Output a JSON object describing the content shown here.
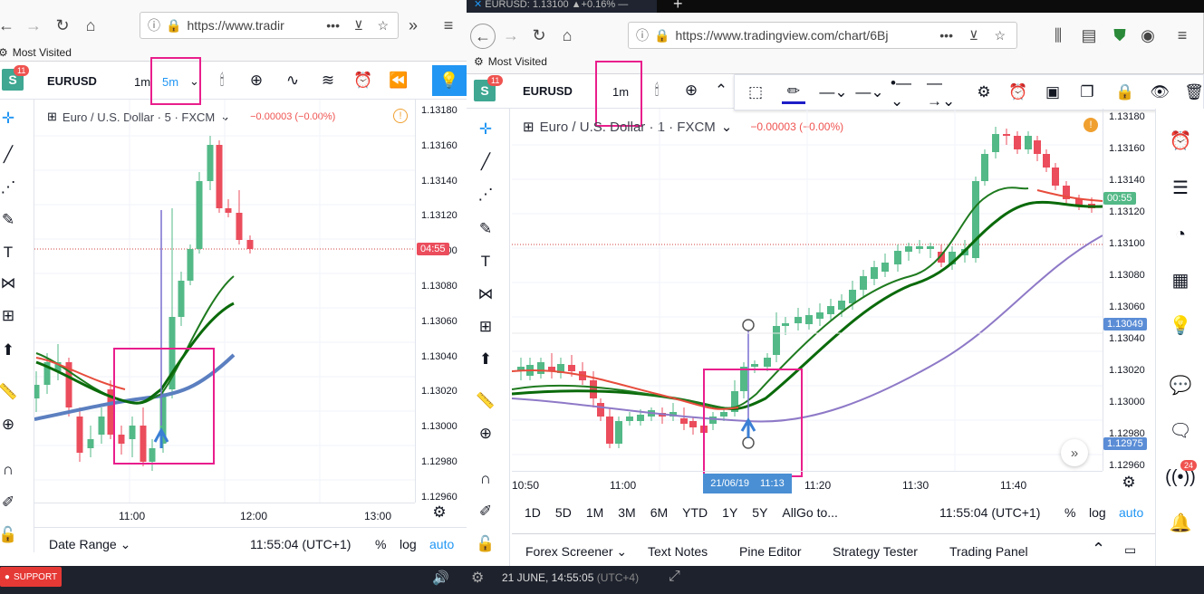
{
  "left_window": {
    "url": "https://www.tradir",
    "bookmarks": "Most Visited",
    "avatar_badge": "11",
    "symbol": "EURUSD",
    "timeframes": [
      "1m",
      "5m"
    ],
    "legend": "Euro / U.S. Dollar · 5 · FXCM",
    "legend_change": "−0.00003 (−0.00%)",
    "price_labels": [
      "1.13180",
      "1.13160",
      "1.13140",
      "1.13120",
      "1.13100",
      "1.13080",
      "1.13060",
      "1.13040",
      "1.13020",
      "1.13000",
      "1.12980",
      "1.12960"
    ],
    "countdown_tag": "04:55",
    "time_labels": [
      "11:00",
      "12:00",
      "13:00"
    ],
    "date_range": "Date Range",
    "clock": "11:55:04 (UTC+1)",
    "pct": "%",
    "log": "log",
    "auto": "auto"
  },
  "right_window": {
    "tab_title": "EURUSD: 1.13100 ▲+0.16% —",
    "url": "https://www.tradingview.com/chart/6Bj",
    "bookmarks": "Most Visited",
    "avatar_badge": "11",
    "symbol": "EURUSD",
    "timeframe": "1m",
    "legend": "Euro / U.S. Dollar · 1 · FXCM",
    "legend_change": "−0.00003 (−0.00%)",
    "price_labels": [
      "1.13180",
      "1.13160",
      "1.13140",
      "1.13120",
      "1.13100",
      "1.13080",
      "1.13060",
      "1.13040",
      "1.13020",
      "1.13000",
      "1.12980",
      "1.12960"
    ],
    "countdown_tag": "00:55",
    "price_tag_1": "1.13049",
    "price_tag_2": "1.12975",
    "time_labels": [
      "10:50",
      "11:00",
      "11:20",
      "11:30",
      "11:40"
    ],
    "cursor_date": "21/06/19",
    "cursor_time": "11:13",
    "ranges": [
      "1D",
      "5D",
      "1M",
      "3M",
      "6M",
      "YTD",
      "1Y",
      "5Y",
      "All"
    ],
    "goto": "Go to...",
    "clock": "11:55:04 (UTC+1)",
    "pct": "%",
    "log": "log",
    "auto": "auto",
    "bottom_tabs": [
      "Forex Screener",
      "Text Notes",
      "Pine Editor",
      "Strategy Tester",
      "Trading Panel"
    ],
    "alerts_badge": "24"
  },
  "taskbar": {
    "support": "SUPPORT",
    "datetime": "21 JUNE, 14:55:05",
    "tz": "(UTC+4)"
  },
  "colors": {
    "bull": "#53b987",
    "bear": "#eb4d5c",
    "highlight": "#e91e8c",
    "accent": "#2196f3"
  }
}
